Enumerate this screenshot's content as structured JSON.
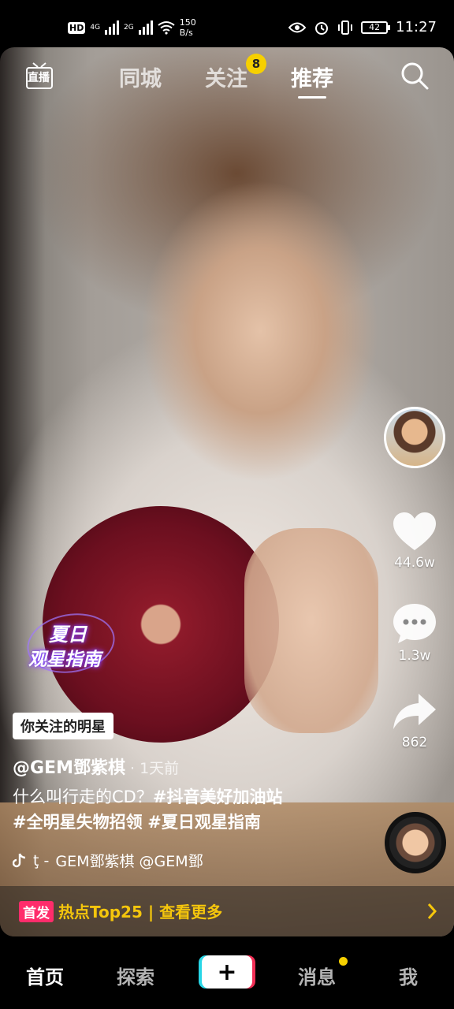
{
  "status_bar": {
    "hd": "HD",
    "sim1": "1",
    "net1": "4G",
    "net2": "2G",
    "speed_value": "150",
    "speed_unit": "B/s",
    "battery": "42",
    "time": "11:27"
  },
  "top_nav": {
    "live_label": "直播",
    "tabs": [
      {
        "label": "同城",
        "active": false
      },
      {
        "label": "关注",
        "active": false
      },
      {
        "label": "推荐",
        "active": true
      }
    ],
    "follow_badge": "8"
  },
  "actions": {
    "likes": "44.6w",
    "comments": "1.3w",
    "shares": "862"
  },
  "sticker": {
    "line1": "夏日",
    "line2": "观星指南"
  },
  "post": {
    "star_tag": "你关注的明星",
    "author": "@GEM鄧紫棋",
    "time": "· 1天前",
    "caption_plain": "什么叫行走的CD？",
    "caption_tag1": "#抖音美好加油站",
    "caption_tag2": "#全明星失物招领",
    "caption_tag3": "#夏日观星指南",
    "music_prefix": "ţ -",
    "music_text": "GEM鄧紫棋 @GEM鄧"
  },
  "hot_bar": {
    "tag": "首发",
    "text": "热点Top25 | 查看更多"
  },
  "bottom_nav": {
    "home": "首页",
    "explore": "探索",
    "create": "+",
    "messages": "消息",
    "me": "我"
  },
  "colors": {
    "badge_yellow": "#f6d000",
    "hot_text": "#f5c60c",
    "hot_tag": "#ff2c6b"
  }
}
